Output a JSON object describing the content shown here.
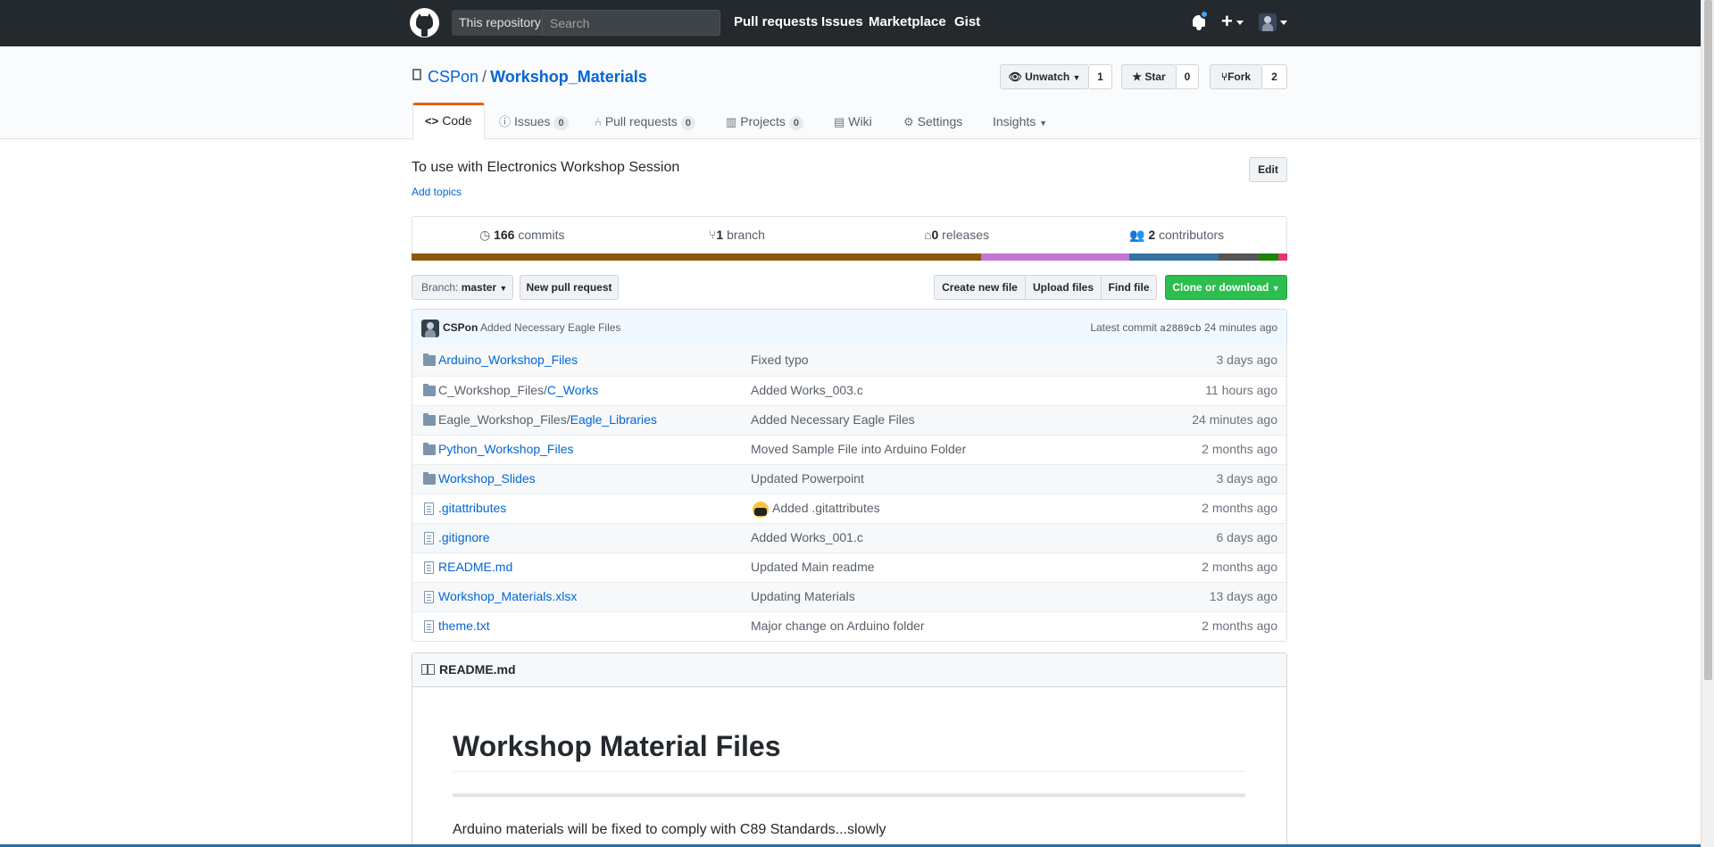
{
  "header": {
    "scope_label": "This repository",
    "search_placeholder": "Search",
    "nav": [
      "Pull requests",
      "Issues",
      "Marketplace",
      "Gist"
    ]
  },
  "repo": {
    "owner": "CSPon",
    "separator": "/",
    "name": "Workshop_Materials",
    "unwatch_label": "Unwatch",
    "watch_count": "1",
    "star_label": "Star",
    "star_count": "0",
    "fork_label": "Fork",
    "fork_count": "2"
  },
  "tabs": {
    "code": "Code",
    "issues": "Issues",
    "issues_count": "0",
    "pulls": "Pull requests",
    "pulls_count": "0",
    "projects": "Projects",
    "projects_count": "0",
    "wiki": "Wiki",
    "settings": "Settings",
    "insights": "Insights"
  },
  "description": {
    "text": "To use with Electronics Workshop Session",
    "add_topics": "Add topics",
    "edit_label": "Edit"
  },
  "summary": {
    "commits_count": "166",
    "commits_label": "commits",
    "branch_count": "1",
    "branch_label": "branch",
    "releases_count": "0",
    "releases_label": "releases",
    "contributors_count": "2",
    "contributors_label": "contributors"
  },
  "language_bar": [
    {
      "color": "#8b5a0a",
      "percent": 65
    },
    {
      "color": "#c475d6",
      "percent": 17
    },
    {
      "color": "#3572a5",
      "percent": 10.2
    },
    {
      "color": "#555555",
      "percent": 4.5
    },
    {
      "color": "#178600",
      "percent": 2.3
    },
    {
      "color": "#e8337a",
      "percent": 1
    }
  ],
  "file_nav": {
    "branch_label": "Branch:",
    "branch_value": "master",
    "new_pr": "New pull request",
    "create_file": "Create new file",
    "upload_files": "Upload files",
    "find_file": "Find file",
    "clone": "Clone or download"
  },
  "latest_commit": {
    "author": "CSPon",
    "message": "Added Necessary Eagle Files",
    "label": "Latest commit",
    "sha": "a2889cb",
    "age": "24 minutes ago"
  },
  "files": [
    {
      "type": "dir",
      "prefix": "",
      "name": "Arduino_Workshop_Files",
      "message": "Fixed typo",
      "age": "3 days ago"
    },
    {
      "type": "dir",
      "prefix": "C_Workshop_Files/",
      "name": "C_Works",
      "message": "Added Works_003.c",
      "age": "11 hours ago"
    },
    {
      "type": "dir",
      "prefix": "Eagle_Workshop_Files/",
      "name": "Eagle_Libraries",
      "message": "Added Necessary Eagle Files",
      "age": "24 minutes ago"
    },
    {
      "type": "dir",
      "prefix": "",
      "name": "Python_Workshop_Files",
      "message": "Moved Sample File into Arduino Folder",
      "age": "2 months ago"
    },
    {
      "type": "dir",
      "prefix": "",
      "name": "Workshop_Slides",
      "message": "Updated Powerpoint",
      "age": "3 days ago"
    },
    {
      "type": "file",
      "prefix": "",
      "name": ".gitattributes",
      "message": "Added .gitattributes",
      "age": "2 months ago"
    },
    {
      "type": "file",
      "prefix": "",
      "name": ".gitignore",
      "message": "Added Works_001.c",
      "age": "6 days ago"
    },
    {
      "type": "file",
      "prefix": "",
      "name": "README.md",
      "message": "Updated Main readme",
      "age": "2 months ago"
    },
    {
      "type": "file",
      "prefix": "",
      "name": "Workshop_Materials.xlsx",
      "message": "Updating Materials",
      "age": "13 days ago"
    },
    {
      "type": "file",
      "prefix": "",
      "name": "theme.txt",
      "message": "Major change on Arduino folder",
      "age": "2 months ago"
    }
  ],
  "readme": {
    "filename": "README.md",
    "heading": "Workshop Material Files",
    "paragraph": "Arduino materials will be fixed to comply with C89 Standards...slowly"
  }
}
